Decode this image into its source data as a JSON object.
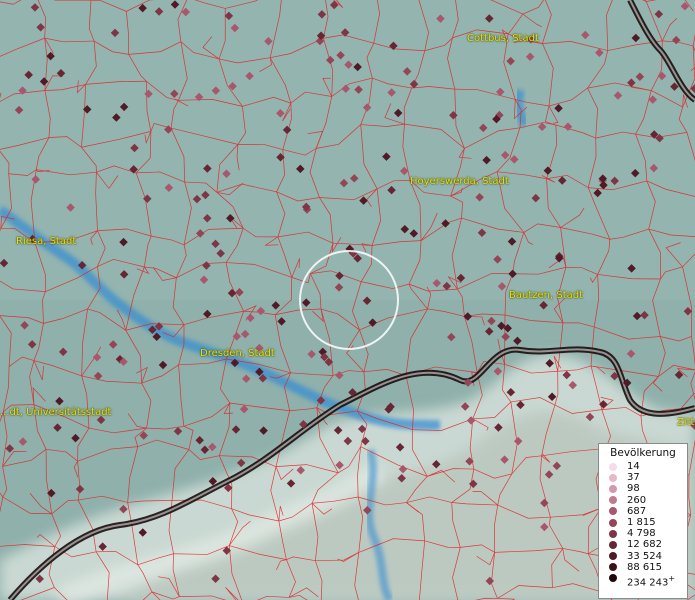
{
  "map": {
    "cities": [
      {
        "name": "Cottbus, Stadt"
      },
      {
        "name": "Hoyerswerda, Stadt"
      },
      {
        "name": "Riesa, Stadt"
      },
      {
        "name": "Bautzen, Stadt"
      },
      {
        "name": "Dresden, Stadt"
      },
      {
        "name": "...dt, Universitätsstadt"
      },
      {
        "name": "Zitt..."
      }
    ],
    "colors": {
      "border_lines": "#e02020",
      "country_border": "#1a0d0d",
      "water": "#3a8fd0",
      "label_text": "#e8e000",
      "terrain": "#8fb0ab"
    }
  },
  "legend": {
    "title": "Bevölkerung",
    "items": [
      {
        "label": "14",
        "color": "#f6dce8"
      },
      {
        "label": "37",
        "color": "#e8b8c8"
      },
      {
        "label": "98",
        "color": "#d398ab"
      },
      {
        "label": "260",
        "color": "#bf7a90"
      },
      {
        "label": "687",
        "color": "#a8576d"
      },
      {
        "label": "1 815",
        "color": "#944556"
      },
      {
        "label": "4 798",
        "color": "#7e3545"
      },
      {
        "label": "12 682",
        "color": "#672634"
      },
      {
        "label": "33 524",
        "color": "#501a26"
      },
      {
        "label": "88 615",
        "color": "#3c121a"
      },
      {
        "label": "234 243",
        "color": "#1f080c"
      }
    ],
    "plus_mark": "+"
  }
}
